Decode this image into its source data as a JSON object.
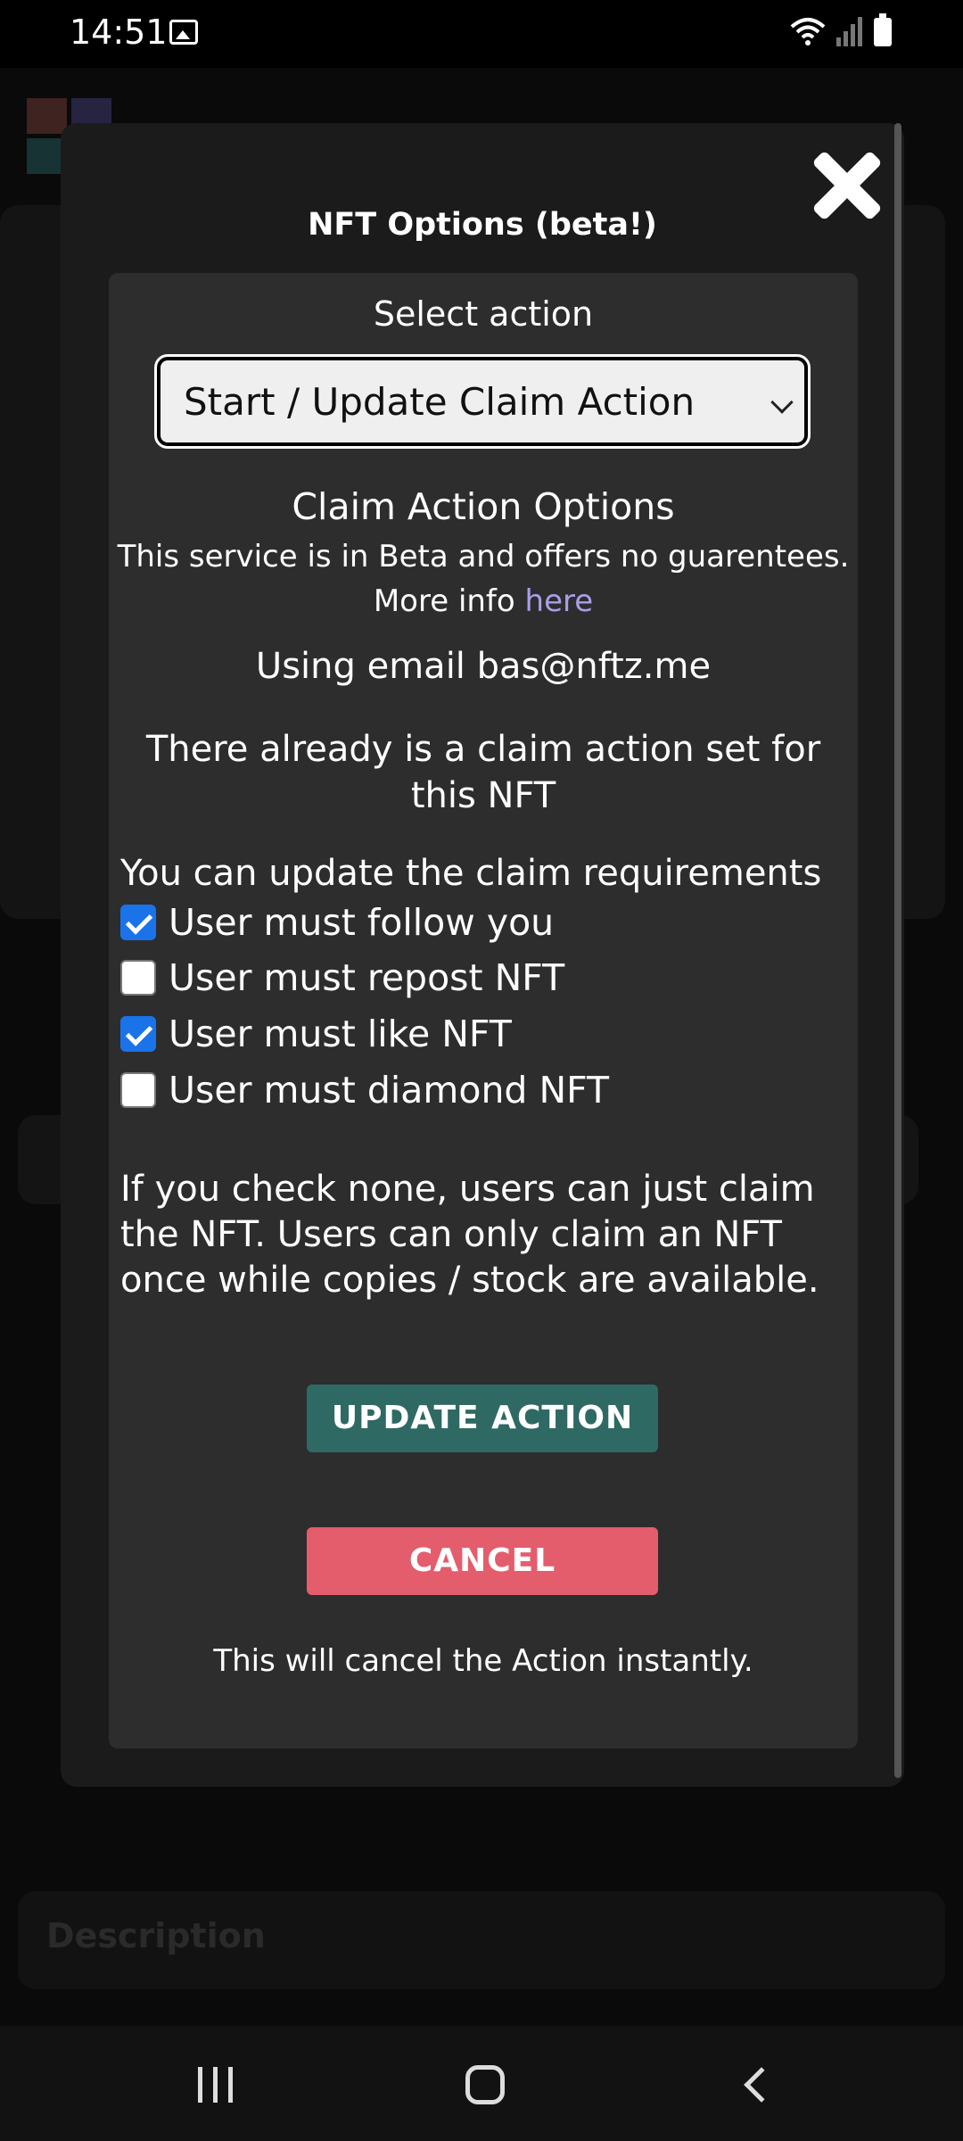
{
  "status_bar": {
    "time": "14:51",
    "icons": [
      "image-icon",
      "wifi-icon",
      "signal-icon",
      "battery-icon"
    ]
  },
  "background": {
    "description_label": "Description"
  },
  "modal": {
    "title": "NFT Options (beta!)",
    "close_icon": "close-icon",
    "select_label": "Select action",
    "select_value": "Start / Update Claim Action",
    "section_title": "Claim Action Options",
    "beta_note": "This service is in Beta and offers no guarentees.",
    "more_info_prefix": "More info",
    "more_info_link": "here",
    "email_text": "Using email bas@nftz.me",
    "existing_note": "There already is a claim action set for this NFT",
    "requirements_heading": "You can update the claim requirements",
    "requirements": [
      {
        "label": "User must follow you",
        "checked": true
      },
      {
        "label": "User must repost NFT",
        "checked": false
      },
      {
        "label": "User must like NFT",
        "checked": true
      },
      {
        "label": "User must diamond NFT",
        "checked": false
      }
    ],
    "info_text": "If you check none, users can just claim the NFT. Users can only claim an NFT once while copies / stock are available.",
    "update_button": "UPDATE ACTION",
    "cancel_button": "CANCEL",
    "cancel_note": "This will cancel the Action instantly."
  },
  "colors": {
    "update_button": "#2f6963",
    "cancel_button": "#e45d6d",
    "link": "#a99fe8",
    "checkbox_checked": "#1a73e8"
  },
  "nav_bar": {
    "icons": [
      "recents-icon",
      "home-icon",
      "back-icon"
    ]
  }
}
